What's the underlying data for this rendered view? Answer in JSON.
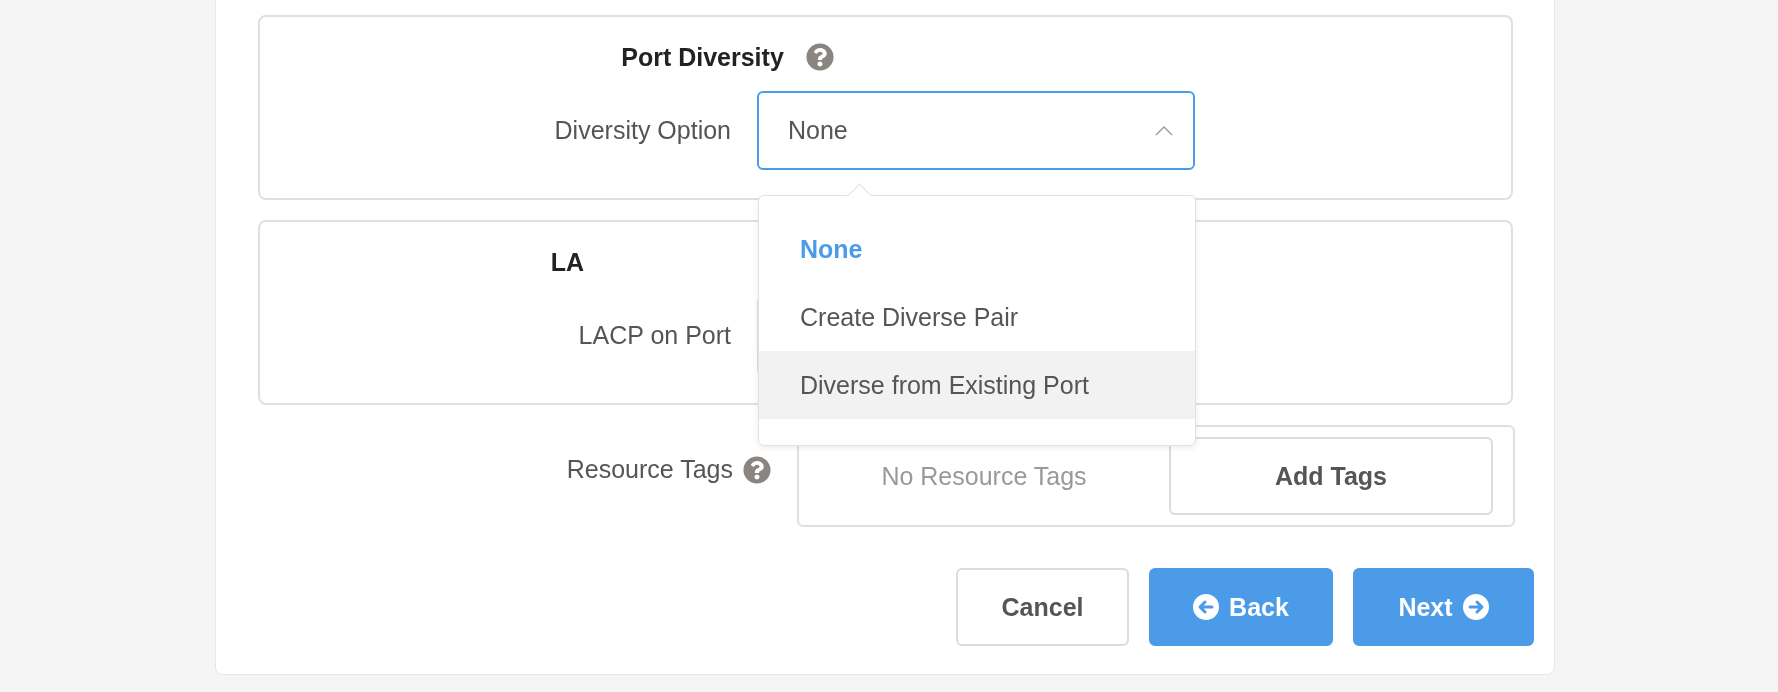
{
  "sections": [
    {
      "title": "Port Diversity",
      "help": true,
      "field": {
        "label": "Diversity Option",
        "value": "None",
        "expanded": true,
        "options": [
          {
            "label": "None",
            "selected": true,
            "highlighted": false
          },
          {
            "label": "Create Diverse Pair",
            "selected": false,
            "highlighted": false
          },
          {
            "label": "Diverse from Existing Port",
            "selected": false,
            "highlighted": true
          }
        ]
      }
    },
    {
      "title": "LA",
      "help": false,
      "field": {
        "label": "LACP on Port",
        "expanded": false
      }
    }
  ],
  "resource_tags": {
    "label": "Resource Tags",
    "help": true,
    "empty_text": "No Resource Tags",
    "add_button": "Add Tags"
  },
  "buttons": [
    {
      "label": "Cancel",
      "kind": "secondary"
    },
    {
      "label": "Back",
      "kind": "back"
    },
    {
      "label": "Next",
      "kind": "next"
    }
  ]
}
